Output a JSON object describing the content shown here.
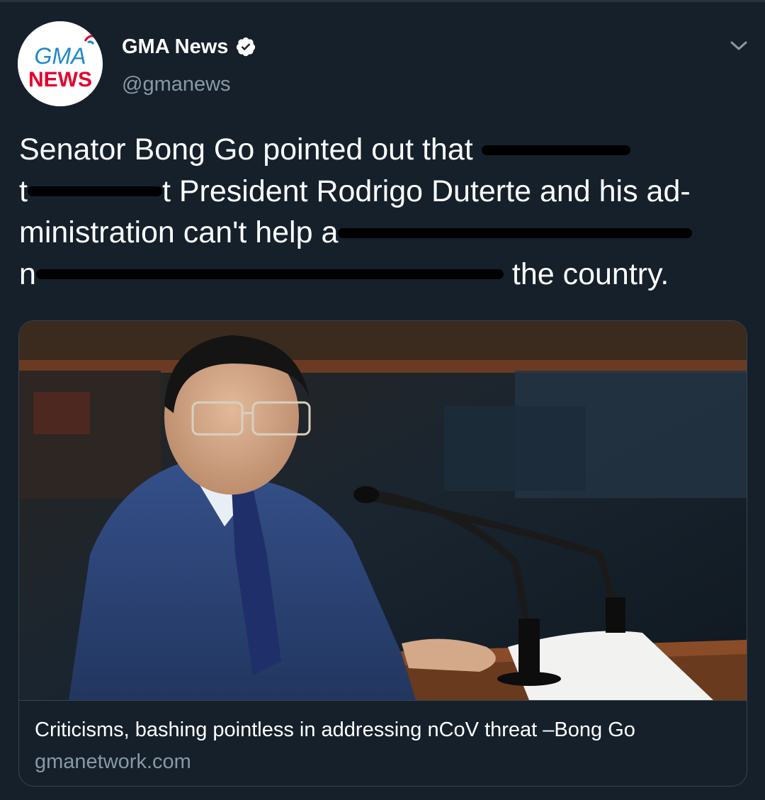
{
  "account": {
    "display_name": "GMA News",
    "handle": "@gmanews",
    "verified": true,
    "avatar_logo_top": "GMA",
    "avatar_logo_bottom": "NEWS"
  },
  "tweet": {
    "lines": [
      "Senator Bong Go pointed out that ",
      "t",
      "t President Rodrigo Duterte and his ad-",
      "ministration can't help a",
      "n",
      " the country."
    ]
  },
  "card": {
    "title": "Criticisms, bashing pointless in addressing nCoV threat –Bong Go",
    "domain": "gmanetwork.com",
    "image_subject": "man-in-blue-suit-at-senate-podium"
  },
  "icons": {
    "verified": "verified-badge-icon",
    "caret": "chevron-down-icon"
  },
  "colors": {
    "background": "#15202b",
    "border": "#38444d",
    "secondary_text": "#8899a6",
    "verified_badge": "#ffffff",
    "logo_red": "#e4002b",
    "logo_blue": "#1e88c8"
  }
}
